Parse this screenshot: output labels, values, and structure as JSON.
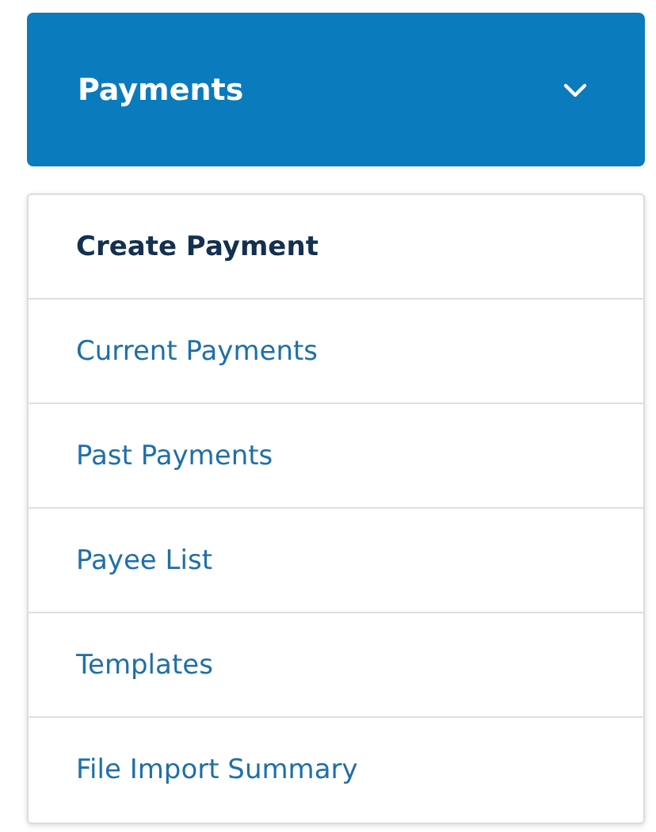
{
  "menu": {
    "title": "Payments",
    "expanded": true,
    "items": [
      {
        "label": "Create Payment",
        "selected": true
      },
      {
        "label": "Current Payments",
        "selected": false
      },
      {
        "label": "Past Payments",
        "selected": false
      },
      {
        "label": "Payee List",
        "selected": false
      },
      {
        "label": "Templates",
        "selected": false
      },
      {
        "label": "File Import Summary",
        "selected": false
      }
    ]
  }
}
